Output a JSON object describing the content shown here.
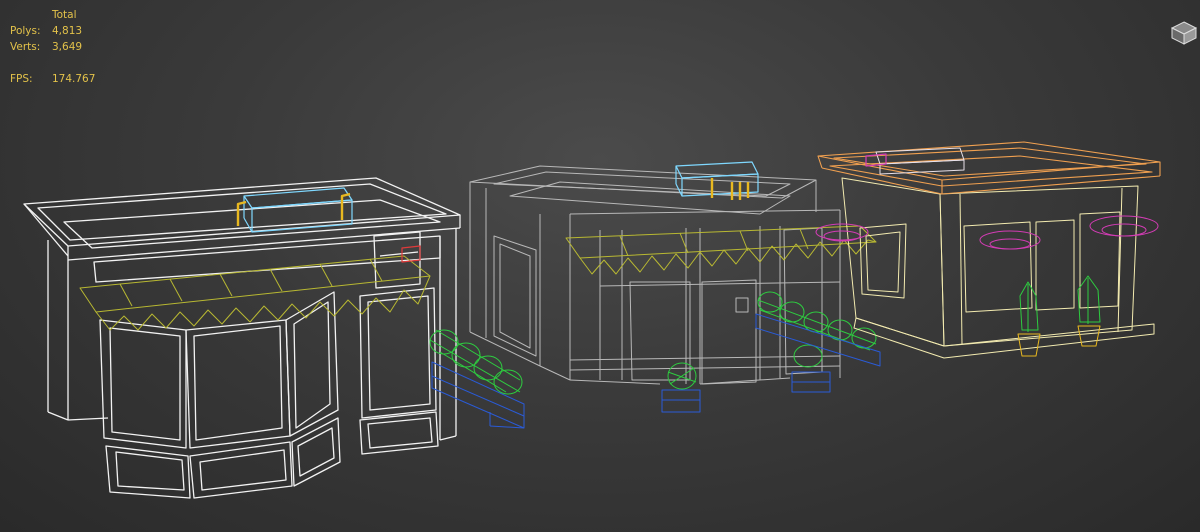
{
  "viewport": {
    "stats": {
      "header": "Total",
      "polys_label": "Polys:",
      "polys_value": "4,813",
      "verts_label": "Verts:",
      "verts_value": "3,649",
      "fps_label": "FPS:",
      "fps_value": "174.767"
    },
    "colors": {
      "background": "#3a3a3a",
      "stats_text": "#e3c24a",
      "wire_white": "#ffffff",
      "wire_grey": "#c8c8c8",
      "wire_yellow": "#c8c832",
      "wire_cyan": "#7fd8ff",
      "wire_gold": "#e8b820",
      "wire_green": "#2ecc40",
      "wire_blue": "#2a5bd7",
      "wire_magenta": "#d23cb4",
      "wire_orange": "#f0a050",
      "wire_red": "#e03a3a",
      "wire_cream": "#f3ebb0"
    },
    "icons": {
      "viewcube": "viewcube-icon"
    }
  }
}
